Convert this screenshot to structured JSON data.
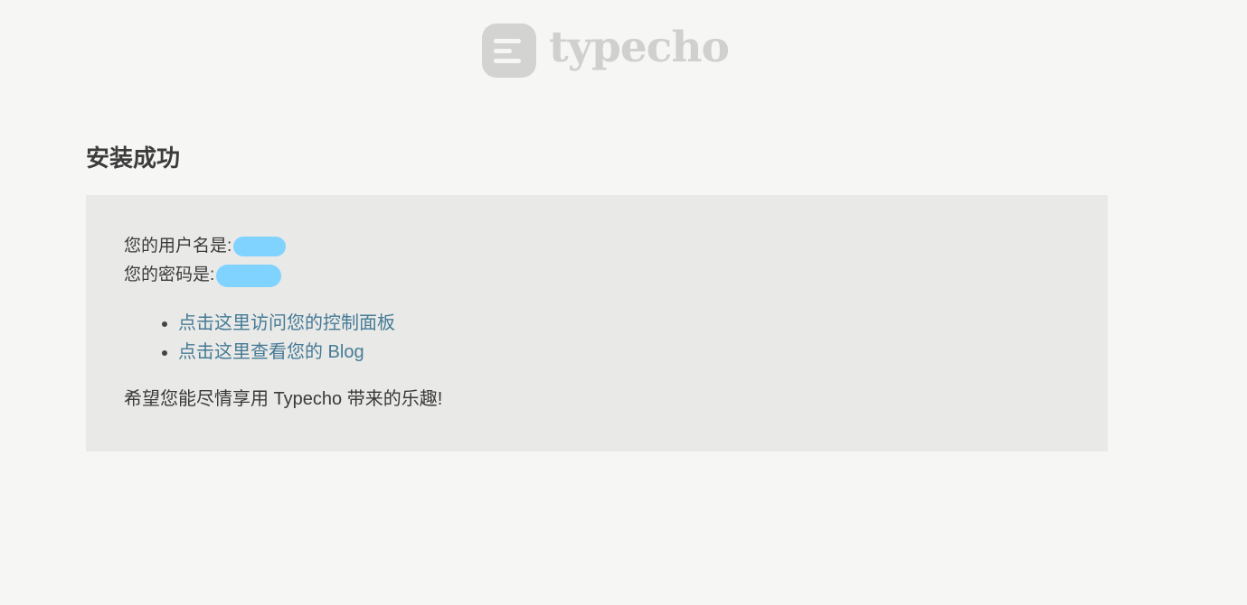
{
  "logo": {
    "text": "typecho"
  },
  "title": "安装成功",
  "credentials": {
    "username_label": "您的用户名是:",
    "password_label": "您的密码是:"
  },
  "links": [
    {
      "label": "点击这里访问您的控制面板"
    },
    {
      "label": "点击这里查看您的 Blog"
    }
  ],
  "closing": "希望您能尽情享用 Typecho 带来的乐趣!",
  "colors": {
    "link": "#467b96",
    "panel": "#e9e9e7",
    "background": "#f6f6f4",
    "redaction": "#80d3ff"
  }
}
